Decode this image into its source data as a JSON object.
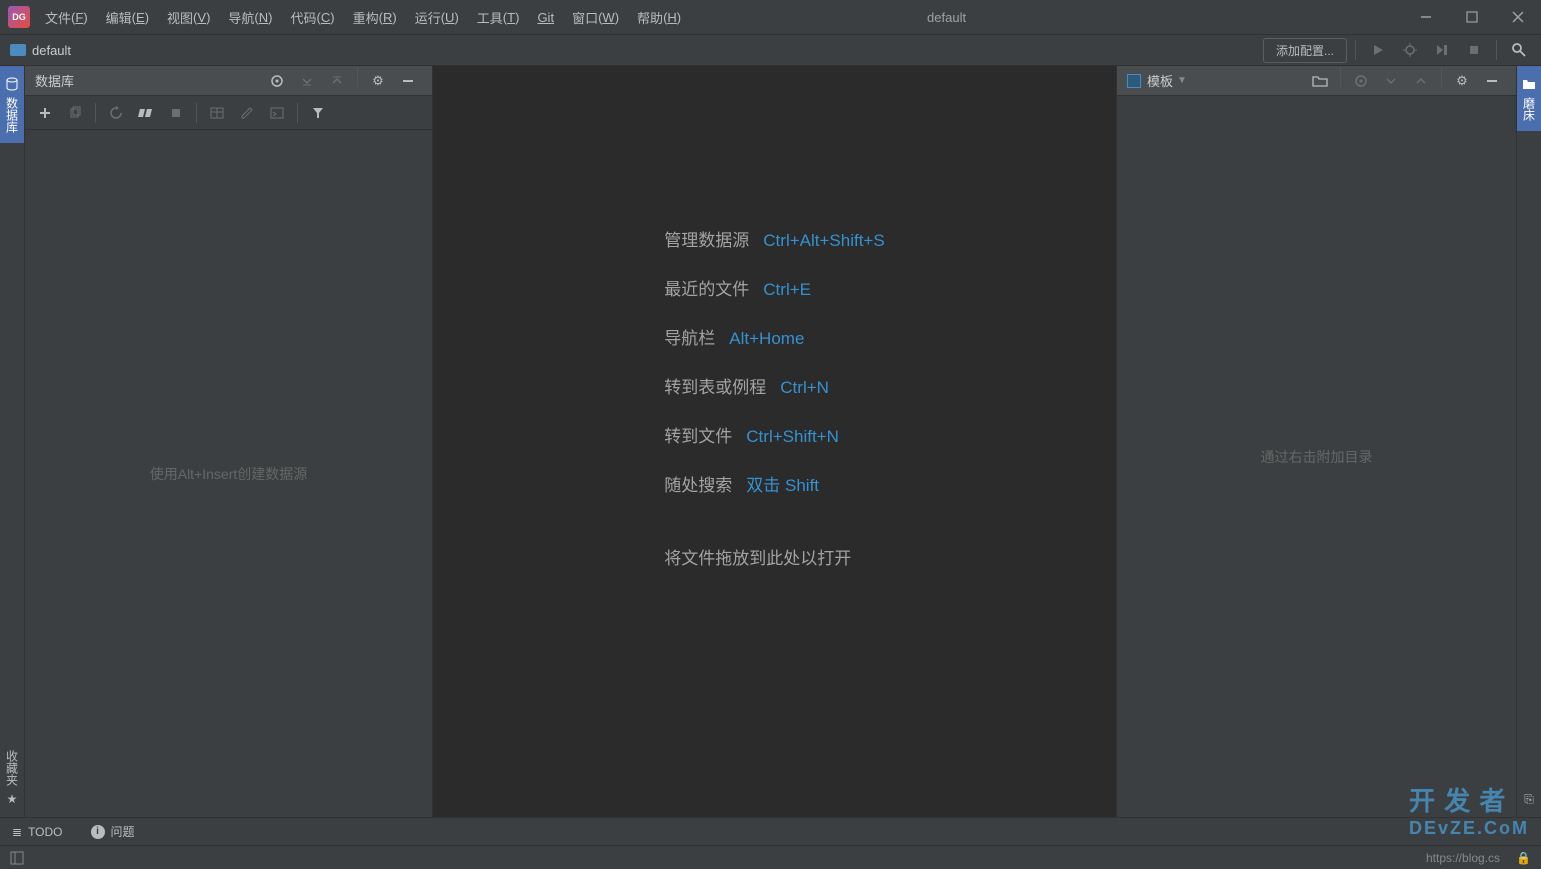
{
  "menubar": {
    "items": [
      {
        "label": "文件",
        "mn": "F"
      },
      {
        "label": "编辑",
        "mn": "E"
      },
      {
        "label": "视图",
        "mn": "V"
      },
      {
        "label": "导航",
        "mn": "N"
      },
      {
        "label": "代码",
        "mn": "C"
      },
      {
        "label": "重构",
        "mn": "R"
      },
      {
        "label": "运行",
        "mn": "U"
      },
      {
        "label": "工具",
        "mn": "T"
      },
      {
        "label": "Git",
        "mn": ""
      },
      {
        "label": "窗口",
        "mn": "W"
      },
      {
        "label": "帮助",
        "mn": "H"
      }
    ],
    "project_title": "default"
  },
  "navbar": {
    "breadcrumb": "default",
    "add_config": "添加配置..."
  },
  "left_panel": {
    "title": "数据库",
    "hint": "使用Alt+Insert创建数据源"
  },
  "right_panel": {
    "title": "模板",
    "hint": "通过右击附加目录"
  },
  "left_strip": {
    "database": "数据库",
    "favorites": "收藏夹"
  },
  "right_strip": {
    "files": "磨床"
  },
  "editor": {
    "shortcuts": [
      {
        "label": "管理数据源",
        "key": "Ctrl+Alt+Shift+S"
      },
      {
        "label": "最近的文件",
        "key": "Ctrl+E"
      },
      {
        "label": "导航栏",
        "key": "Alt+Home"
      },
      {
        "label": "转到表或例程",
        "key": "Ctrl+N"
      },
      {
        "label": "转到文件",
        "key": "Ctrl+Shift+N"
      },
      {
        "label": "随处搜索",
        "key": "双击 Shift"
      }
    ],
    "drag_hint": "将文件拖放到此处以打开"
  },
  "bottombar": {
    "todo": "TODO",
    "problems": "问题"
  },
  "statusbar": {
    "url": "https://blog.cs",
    "lock": ""
  },
  "watermark": {
    "l1": "开 发 者",
    "l2": "DEvZE.CoM"
  }
}
